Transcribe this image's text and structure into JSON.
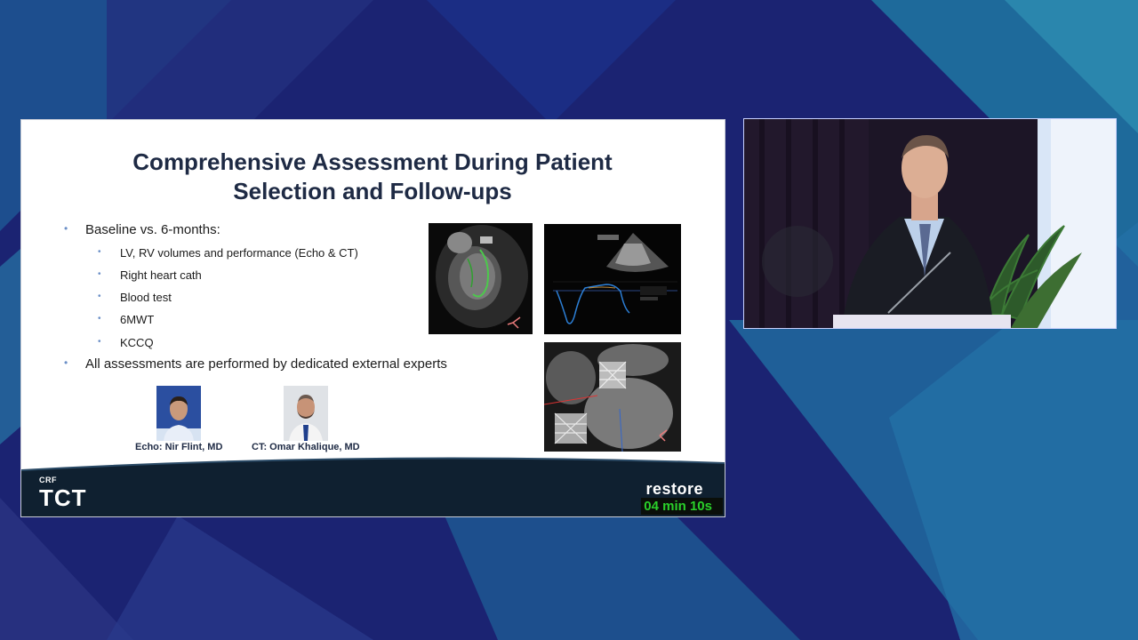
{
  "slide": {
    "title_line1": "Comprehensive Assessment During Patient",
    "title_line2": "Selection and Follow-ups",
    "bullets": [
      {
        "level": 1,
        "text": "Baseline vs. 6-months:"
      },
      {
        "level": 2,
        "text": "LV, RV volumes and performance (Echo & CT)"
      },
      {
        "level": 2,
        "text": "Right heart cath"
      },
      {
        "level": 2,
        "text": "Blood test"
      },
      {
        "level": 2,
        "text": "6MWT"
      },
      {
        "level": 2,
        "text": "KCCQ"
      },
      {
        "level": 1,
        "text": "All assessments are performed by dedicated external experts"
      }
    ],
    "experts": [
      {
        "caption": "Echo: Nir Flint, MD"
      },
      {
        "caption": "CT: Omar Khalique, MD"
      }
    ],
    "footer": {
      "crf": "CRF",
      "tct": "TCT",
      "brand": "restore",
      "timer": "04 min 10s"
    }
  },
  "colors": {
    "background": "#1a2470",
    "accent_teal": "#1f7fa8",
    "title": "#1e2a44",
    "footer": "#0f2030",
    "timer_text": "#2ad02a",
    "bullet_dot": "#6b8fc7"
  }
}
